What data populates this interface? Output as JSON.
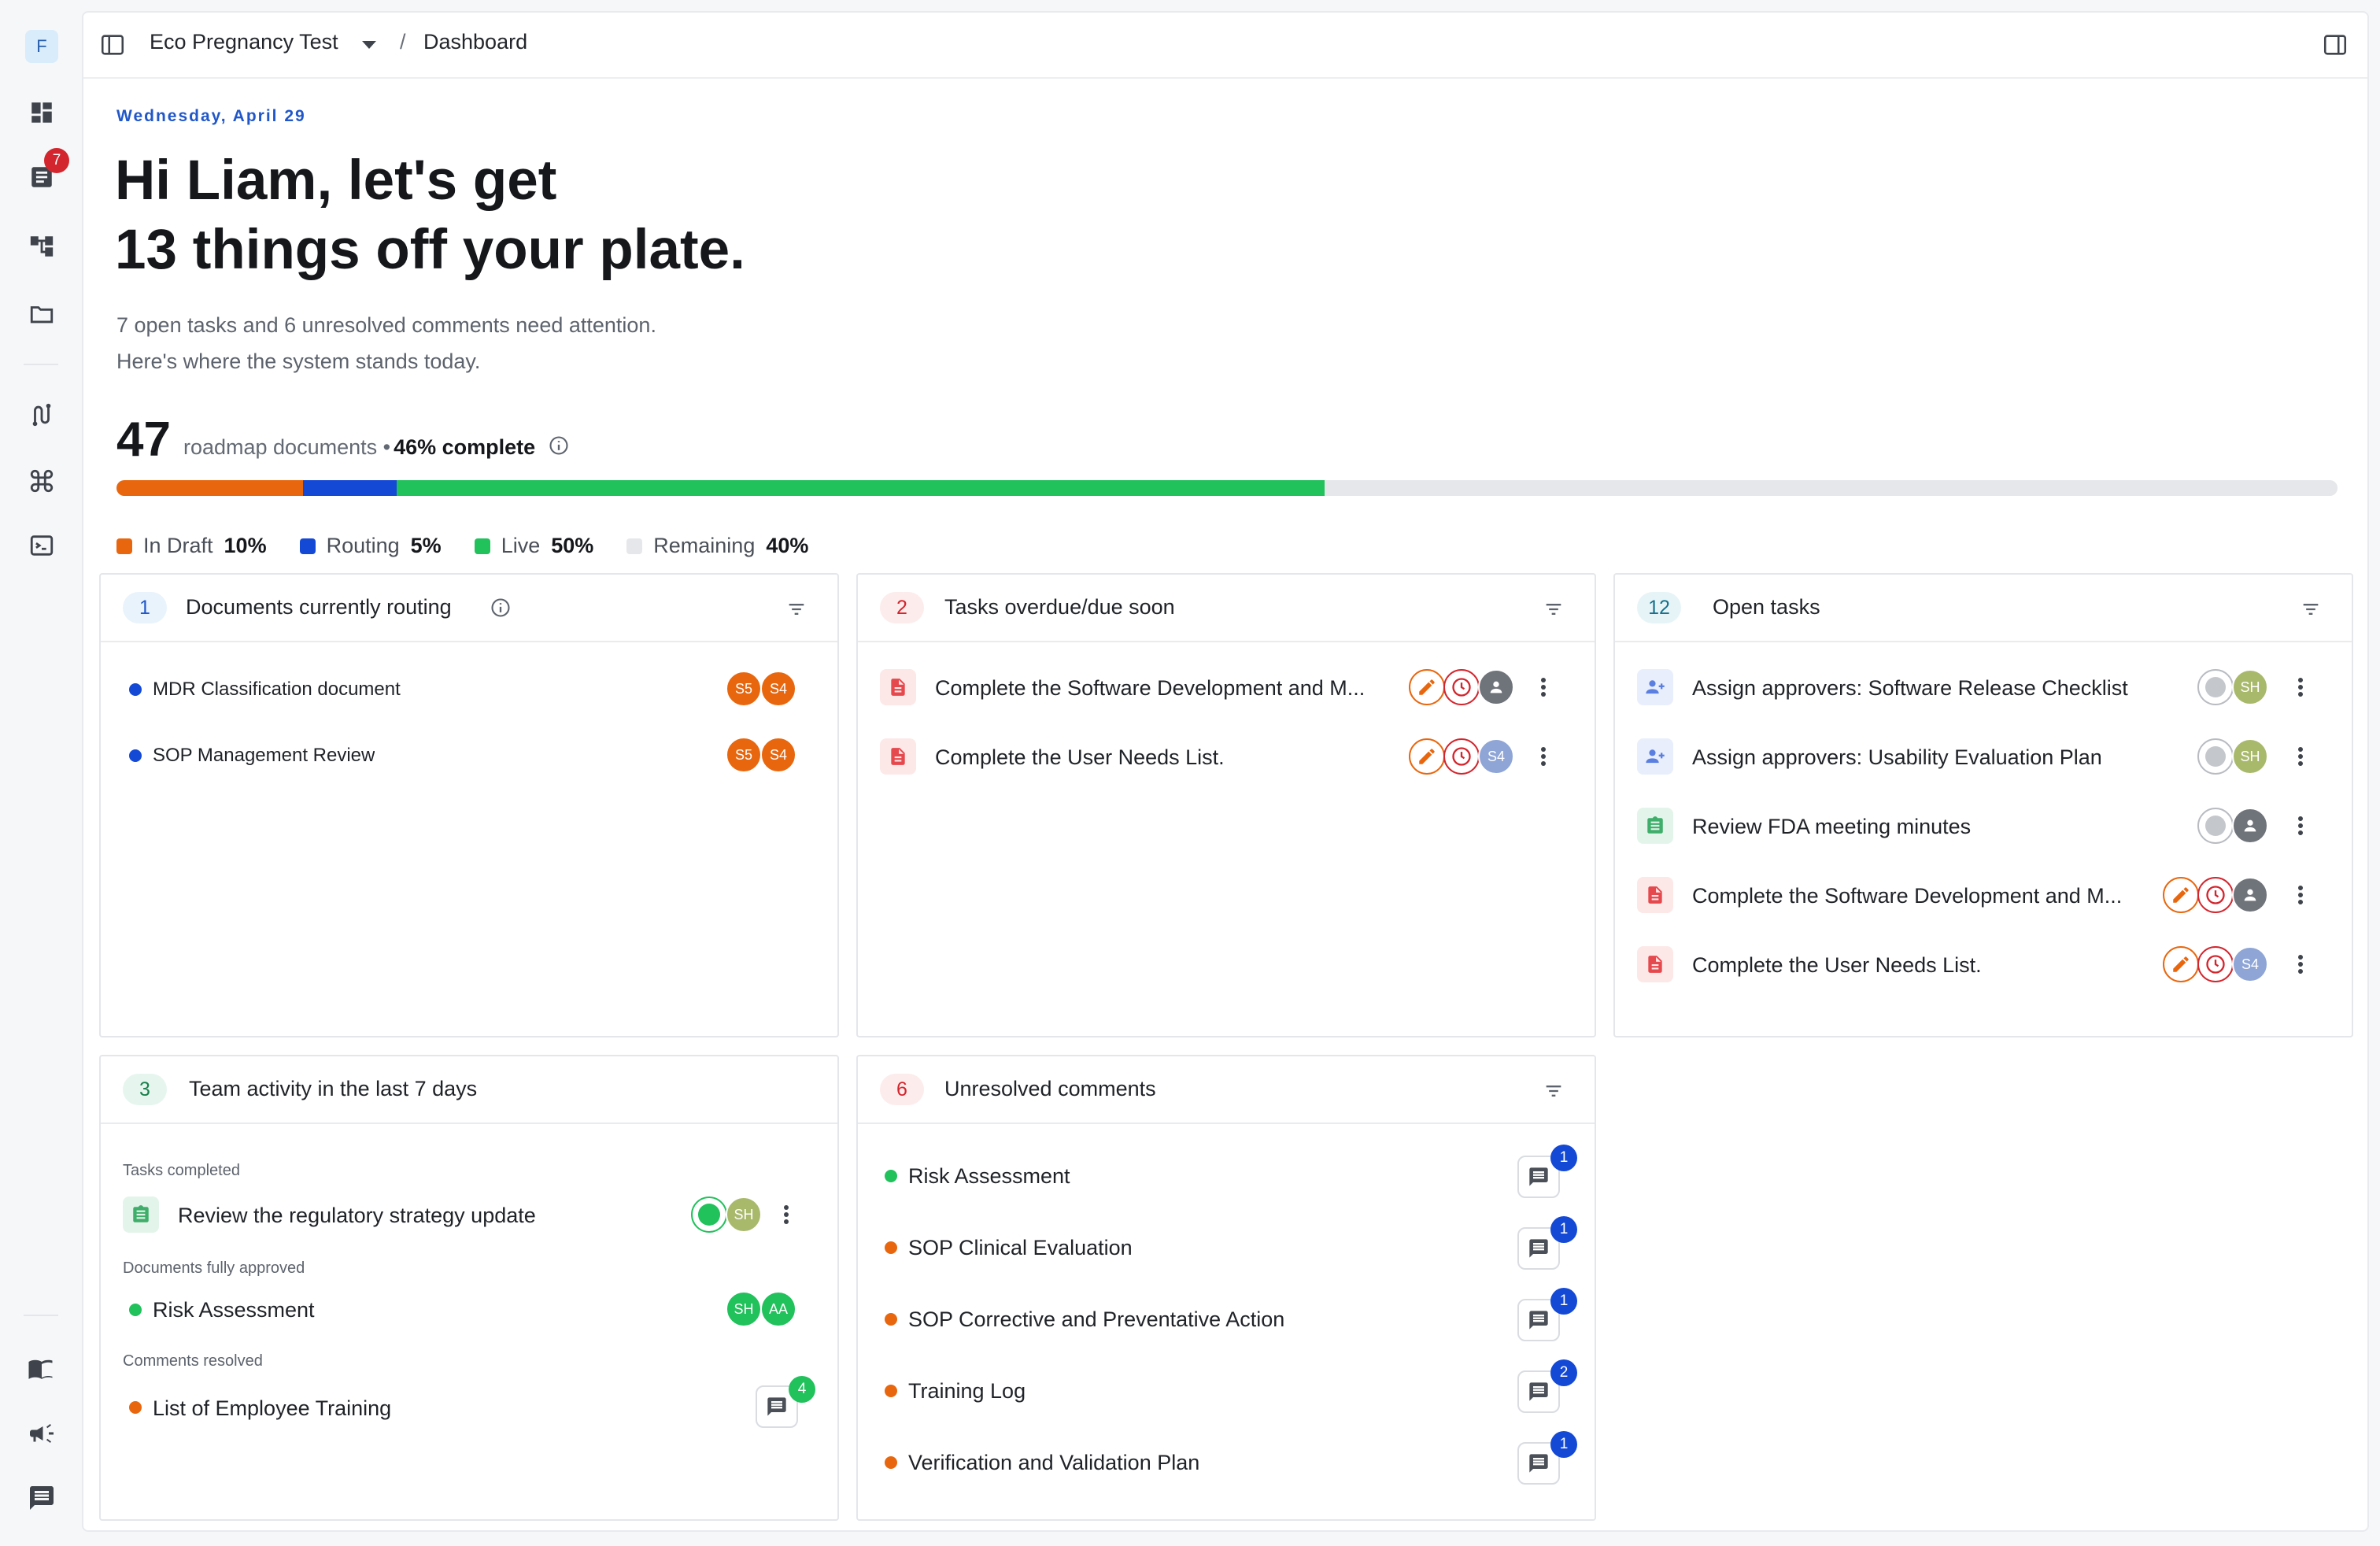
{
  "workspace": {
    "initial": "F"
  },
  "nav": {
    "notifications_badge": "7"
  },
  "topbar": {
    "project": "Eco Pregnancy Test",
    "separator": "/",
    "page": "Dashboard"
  },
  "greeting": {
    "date": "Wednesday, April 29",
    "headline_1": "Hi Liam, let's get",
    "headline_2": "13 things off your plate.",
    "sub_1": "7 open tasks and 6 unresolved comments need attention.",
    "sub_2": "Here's where the system stands today."
  },
  "stats": {
    "total": "47",
    "label": "roadmap documents •",
    "complete": "46% complete",
    "progress": [
      {
        "name": "In Draft",
        "pct": "10%",
        "value": 0.084,
        "color": "#e8670e"
      },
      {
        "name": "Routing",
        "pct": "5%",
        "value": 0.042,
        "color": "#1449d6"
      },
      {
        "name": "Live",
        "pct": "50%",
        "value": 0.418,
        "color": "#21c15c"
      },
      {
        "name": "Remaining",
        "pct": "40%",
        "value": 0.456,
        "color": "#e6e7ea"
      }
    ]
  },
  "routing": {
    "count": "1",
    "title": "Documents currently routing",
    "items": [
      {
        "name": "MDR Classification document",
        "avatars": [
          "S5",
          "S4"
        ]
      },
      {
        "name": "SOP Management Review",
        "avatars": [
          "S5",
          "S4"
        ]
      }
    ]
  },
  "overdue": {
    "count": "2",
    "title": "Tasks overdue/due soon",
    "items": [
      {
        "name": "Complete the Software Development and M...",
        "assignee": ""
      },
      {
        "name": "Complete the User Needs List.",
        "assignee": "S4"
      }
    ]
  },
  "open_tasks": {
    "count": "12",
    "title": "Open tasks",
    "items": [
      {
        "name": "Assign approvers: Software Release Checklist",
        "assignee": "SH"
      },
      {
        "name": "Assign approvers: Usability Evaluation Plan",
        "assignee": "SH"
      },
      {
        "name": "Review FDA meeting minutes",
        "assignee": ""
      },
      {
        "name": "Complete the Software Development and M...",
        "assignee": ""
      },
      {
        "name": "Complete the User Needs List.",
        "assignee": "S4"
      }
    ]
  },
  "activity": {
    "count": "3",
    "title": "Team activity in the last 7 days",
    "sections": [
      {
        "label": "Tasks completed",
        "item": "Review the regulatory strategy update",
        "avatars": [
          "SH"
        ]
      },
      {
        "label": "Documents fully approved",
        "item": "Risk Assessment",
        "avatars": [
          "SH",
          "AA"
        ]
      },
      {
        "label": "Comments resolved",
        "item": "List of Employee Training",
        "comments": "4"
      }
    ]
  },
  "comments": {
    "count": "6",
    "title": "Unresolved comments",
    "items": [
      {
        "name": "Risk Assessment",
        "count": "1"
      },
      {
        "name": "SOP Clinical Evaluation",
        "count": "1"
      },
      {
        "name": "SOP Corrective and Preventative Action",
        "count": "1"
      },
      {
        "name": "Training Log",
        "count": "2"
      },
      {
        "name": "Verification and Validation Plan",
        "count": "1"
      }
    ]
  },
  "colors": {
    "accent": "#2157c9",
    "draft": "#e8670e",
    "routing": "#1449d6",
    "live": "#21c15c",
    "overdue": "#d3252d"
  }
}
